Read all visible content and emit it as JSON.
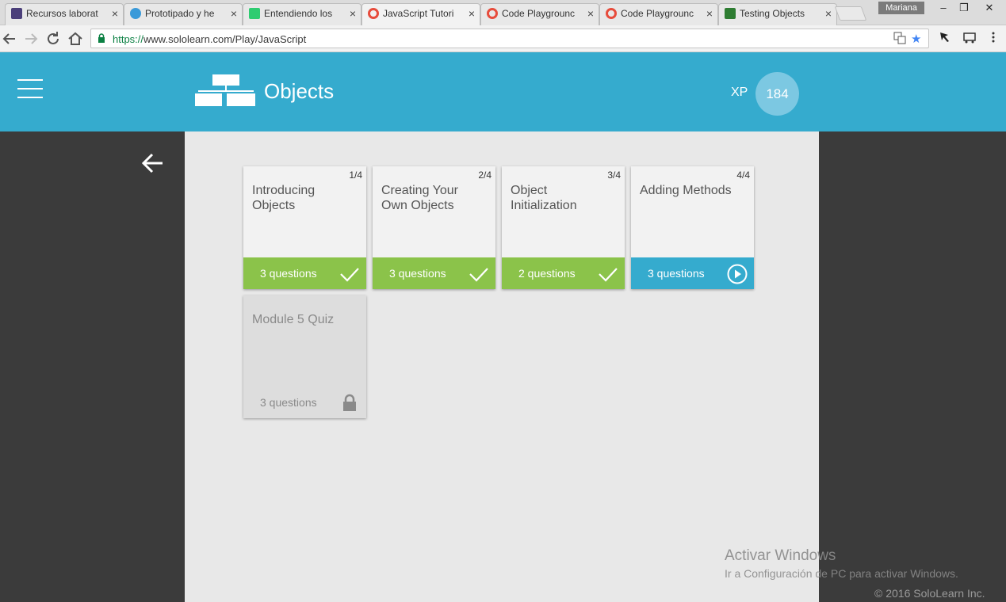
{
  "browser": {
    "tabs": [
      {
        "title": "Recursos laborat",
        "favicon_color": "#4b3f7a",
        "active": false
      },
      {
        "title": "Prototipado y he",
        "favicon_color": "#3a9ad9",
        "active": false
      },
      {
        "title": "Entendiendo los",
        "favicon_color": "#2ecc71",
        "active": false
      },
      {
        "title": "JavaScript Tutori",
        "favicon_color": "#e74c3c",
        "active": true
      },
      {
        "title": "Code Playgrounc",
        "favicon_color": "#e74c3c",
        "active": false
      },
      {
        "title": "Code Playgrounc",
        "favicon_color": "#e74c3c",
        "active": false
      },
      {
        "title": "Testing Objects",
        "favicon_color": "#2e7d32",
        "active": false
      }
    ],
    "close_glyph": "×",
    "user": "Mariana",
    "window_controls": {
      "minimize": "–",
      "restore": "❐",
      "close": "✕"
    },
    "url_scheme": "https://",
    "url_rest": "www.sololearn.com/Play/JavaScript",
    "icons": [
      "back-icon",
      "forward-icon",
      "reload-icon",
      "home-icon",
      "lock-icon",
      "translate-icon",
      "star-icon",
      "extension-icon",
      "cast-icon",
      "menu-icon"
    ]
  },
  "header": {
    "title": "Objects",
    "xp_label": "XP",
    "xp_value": "184",
    "background": "#35abce"
  },
  "lessons": [
    {
      "number": "1/4",
      "title": "Introducing Objects",
      "questions": "3 questions",
      "status": "completed"
    },
    {
      "number": "2/4",
      "title": "Creating Your Own Objects",
      "questions": "3 questions",
      "status": "completed"
    },
    {
      "number": "3/4",
      "title": "Object Initialization",
      "questions": "2 questions",
      "status": "completed"
    },
    {
      "number": "4/4",
      "title": "Adding Methods",
      "questions": "3 questions",
      "status": "current"
    }
  ],
  "quiz": {
    "title": "Module 5 Quiz",
    "questions": "3 questions",
    "status": "locked"
  },
  "colors": {
    "completed": "#8bc34a",
    "current": "#35abce",
    "locked": "#dddddd"
  },
  "watermark": {
    "line1": "Activar Windows",
    "line2": "Ir a Configuración de PC para activar Windows."
  },
  "footer": "© 2016 SoloLearn Inc."
}
